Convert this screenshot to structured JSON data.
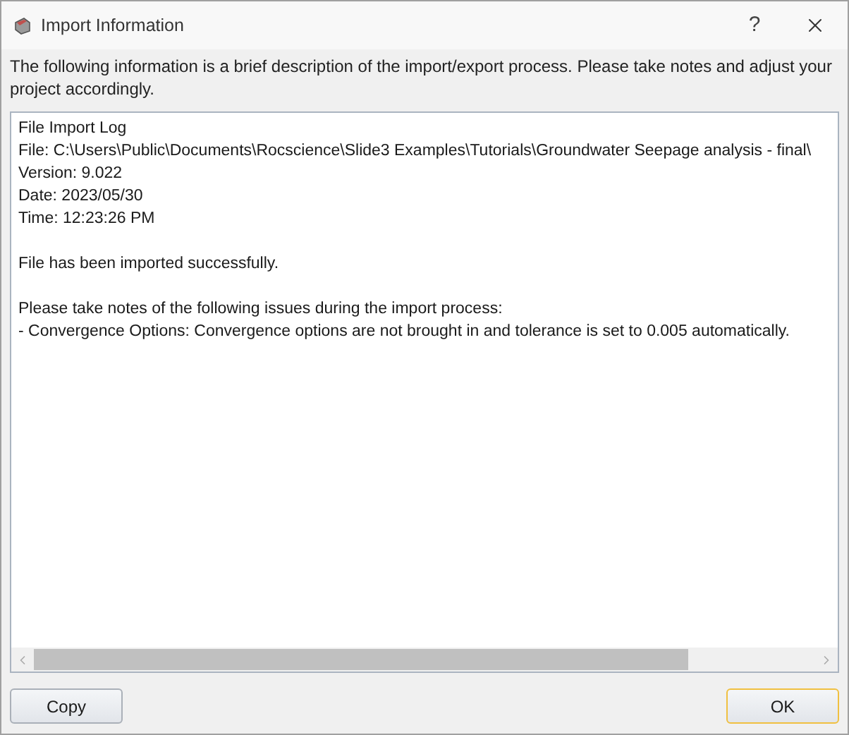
{
  "window": {
    "title": "Import Information",
    "help": "?"
  },
  "description": "The following information is a brief description of the import/export process. Please take notes and adjust your project accordingly.",
  "log_blocks": [
    [
      "File Import Log",
      "File: C:\\Users\\Public\\Documents\\Rocscience\\Slide3 Examples\\Tutorials\\Groundwater Seepage analysis - final\\",
      "Version: 9.022",
      "Date: 2023/05/30",
      "Time: 12:23:26 PM"
    ],
    [
      "File has been imported successfully."
    ],
    [
      "Please take notes of the following issues during the import process:",
      "- Convergence Options: Convergence options are not brought in and tolerance is set to 0.005 automatically."
    ]
  ],
  "buttons": [
    {
      "label": "Copy",
      "default": false
    },
    {
      "label": "OK",
      "default": true
    }
  ]
}
